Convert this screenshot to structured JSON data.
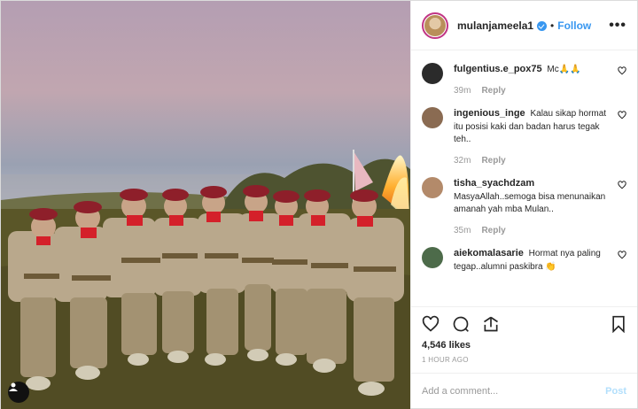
{
  "post": {
    "username": "mulanjameela1",
    "dot": "•",
    "follow_label": "Follow",
    "more_label": "•••",
    "likes": "4,546 likes",
    "timestamp": "1 HOUR AGO",
    "add_comment_placeholder": "Add a comment...",
    "post_label": "Post"
  },
  "comments": [
    {
      "user": "fulgentius.e_pox75",
      "text": "Mc🙏🙏",
      "time": "39m",
      "reply": "Reply"
    },
    {
      "user": "ingenious_inge",
      "text": "Kalau sikap hormat itu posisi kaki dan badan harus tegak teh..",
      "time": "32m",
      "reply": "Reply"
    },
    {
      "user": "tisha_syachdzam",
      "text": "MasyaAllah..semoga bisa menunaikan amanah yah mba Mulan..",
      "time": "35m",
      "reply": "Reply"
    },
    {
      "user": "aiekomalasarie",
      "text": "Hormat nya paling tegap..alumni paskibra 👏"
    }
  ],
  "colors": {
    "link": "#3897f0",
    "muted": "#999999",
    "post_disabled": "#b2dffc"
  },
  "icons": [
    "user-tag-icon",
    "verified-icon",
    "heart-icon",
    "comment-icon",
    "share-icon",
    "bookmark-icon"
  ]
}
